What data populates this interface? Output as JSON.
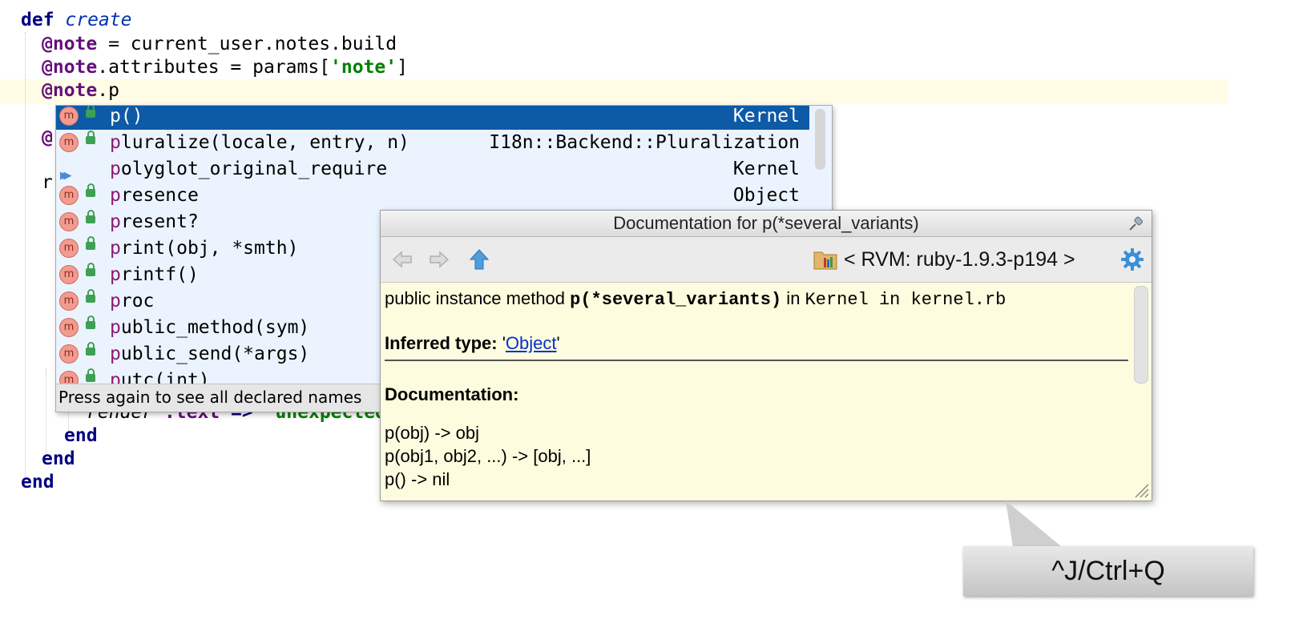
{
  "editor": {
    "lines": [
      {
        "indent": 26,
        "parts": [
          {
            "t": "def ",
            "c": "kw"
          },
          {
            "t": "create",
            "c": "itblue"
          }
        ]
      },
      {
        "indent": 52,
        "parts": [
          {
            "t": "@note",
            "c": "ivar"
          },
          {
            "t": " = current_user.notes.build",
            "c": ""
          }
        ]
      },
      {
        "indent": 52,
        "parts": [
          {
            "t": "@note",
            "c": "ivar"
          },
          {
            "t": ".attributes = params[",
            "c": ""
          },
          {
            "t": "'note'",
            "c": "str"
          },
          {
            "t": "]",
            "c": ""
          }
        ]
      },
      {
        "indent": 52,
        "parts": [
          {
            "t": "@note",
            "c": "ivar"
          },
          {
            "t": ".p",
            "c": ""
          }
        ]
      },
      {
        "indent": 52,
        "parts": [
          {
            "t": "@",
            "c": "ivar"
          }
        ]
      },
      {
        "indent": 52,
        "parts": [
          {
            "t": "r",
            "c": ""
          }
        ]
      },
      {
        "indent": 108,
        "parts": [
          {
            "t": "render",
            "c": "it"
          },
          {
            "t": " ",
            "c": ""
          },
          {
            "t": ":text",
            "c": "sym"
          },
          {
            "t": " => ",
            "c": "kw"
          },
          {
            "t": "'unexpected",
            "c": "str"
          }
        ]
      },
      {
        "indent": 80,
        "parts": [
          {
            "t": "end",
            "c": "kw"
          }
        ]
      },
      {
        "indent": 52,
        "parts": [
          {
            "t": "end",
            "c": "kw"
          }
        ]
      },
      {
        "indent": 26,
        "parts": [
          {
            "t": "end",
            "c": "kw"
          }
        ]
      }
    ]
  },
  "completion": {
    "items": [
      {
        "prefix": "p",
        "rest": "()",
        "type": "Kernel",
        "icon": "method-icon",
        "selected": true
      },
      {
        "prefix": "p",
        "rest": "luralize(locale, entry, n)",
        "type": "I18n::Backend::Pluralization",
        "icon": "method-icon",
        "selected": false
      },
      {
        "prefix": "p",
        "rest": "olyglot_original_require",
        "type": "Kernel",
        "icon": "play-icon",
        "selected": false
      },
      {
        "prefix": "p",
        "rest": "resence",
        "type": "Object",
        "icon": "method-icon",
        "selected": false
      },
      {
        "prefix": "p",
        "rest": "resent?",
        "type": "",
        "icon": "method-icon",
        "selected": false
      },
      {
        "prefix": "p",
        "rest": "rint(obj, *smth)",
        "type": "",
        "icon": "method-icon",
        "selected": false
      },
      {
        "prefix": "p",
        "rest": "rintf()",
        "type": "",
        "icon": "method-icon",
        "selected": false
      },
      {
        "prefix": "p",
        "rest": "roc",
        "type": "",
        "icon": "method-icon",
        "selected": false
      },
      {
        "prefix": "p",
        "rest": "ublic_method(sym)",
        "type": "",
        "icon": "method-icon",
        "selected": false
      },
      {
        "prefix": "p",
        "rest": "ublic_send(*args)",
        "type": "",
        "icon": "method-icon",
        "selected": false
      },
      {
        "prefix": "p",
        "rest": "utc(int)",
        "type": "",
        "icon": "method-icon",
        "selected": false
      }
    ],
    "method_icon_letter": "m",
    "footer": "Press again to see all declared names"
  },
  "doc": {
    "title": "Documentation for p(*several_variants)",
    "rvm_label": "< RVM: ruby-1.9.3-p194 >",
    "sig_prefix": "public instance method ",
    "sig_name": "p(*several_variants)",
    "sig_in": " in ",
    "sig_location": "Kernel in kernel.rb",
    "inferred_label": "Inferred type:",
    "inferred_quote_open": " '",
    "inferred_type": "Object",
    "inferred_quote_close": "'",
    "doc_heading": "Documentation:",
    "doc_lines": [
      "p(obj) -> obj",
      "p(obj1, obj2, ...) -> [obj, ...]",
      "p() -> nil"
    ]
  },
  "shortcut": {
    "label": "^J/Ctrl+Q"
  },
  "colors": {
    "selection": "#0d5aa7",
    "completion_bg": "#ebf4fe",
    "doc_bg": "#fdfcdf",
    "caret_line": "#fffde6"
  }
}
